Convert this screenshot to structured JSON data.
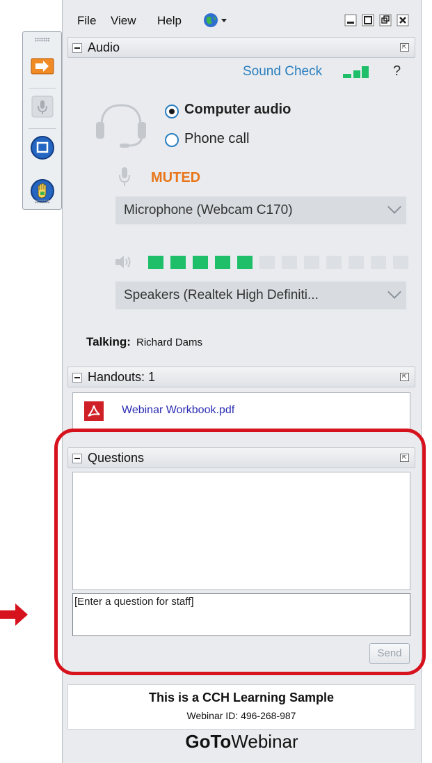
{
  "menu": {
    "file": "File",
    "view": "View",
    "help": "Help"
  },
  "audio": {
    "title": "Audio",
    "sound_check": "Sound Check",
    "help_mark": "?",
    "computer_audio": "Computer audio",
    "phone_call": "Phone call",
    "muted": "MUTED",
    "microphone": "Microphone (Webcam C170)",
    "speaker_level_on": 5,
    "speaker_level_total": 12,
    "speakers": "Speakers (Realtek High Definiti...",
    "talking_label": "Talking:",
    "talking_name": "Richard Dams"
  },
  "handouts": {
    "title": "Handouts: 1",
    "file": "Webinar Workbook.pdf"
  },
  "questions": {
    "title": "Questions",
    "placeholder": "[Enter a question for staff]",
    "send": "Send"
  },
  "footer": {
    "title": "This is a CCH Learning Sample",
    "webinar_id": "Webinar ID: 496-268-987",
    "brand_bold": "GoTo",
    "brand_light": "Webinar"
  },
  "colors": {
    "accent_blue": "#2a7fc0",
    "muted_orange": "#e8761a",
    "level_green": "#1fbf6a",
    "highlight_red": "#d6121d"
  }
}
